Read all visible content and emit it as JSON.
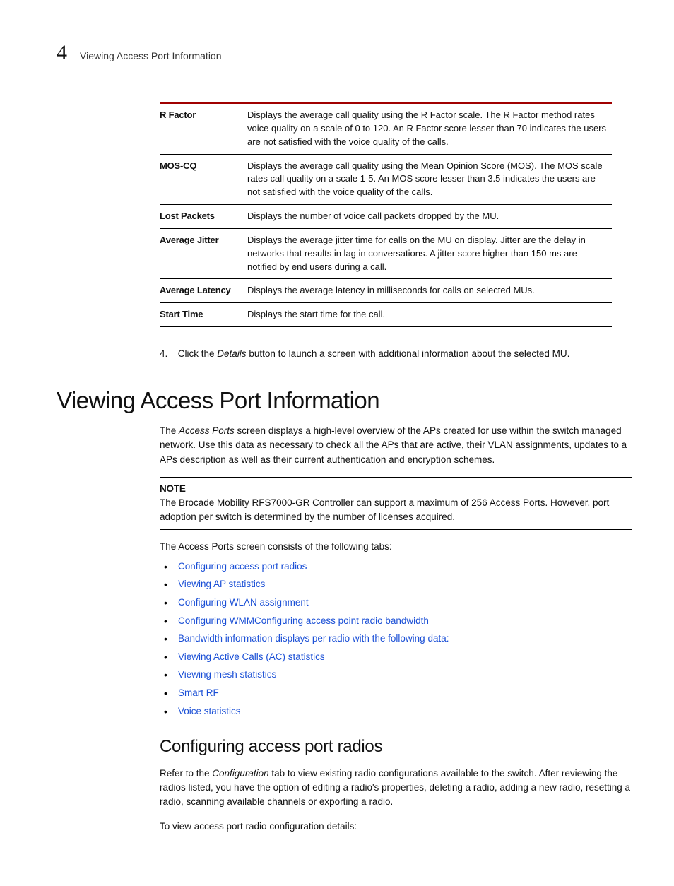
{
  "header": {
    "chapter_number": "4",
    "chapter_title": "Viewing Access Port Information"
  },
  "table": {
    "rows": [
      {
        "term": "R Factor",
        "desc": "Displays the average call quality using the R Factor scale. The R Factor method rates voice quality on a scale of 0 to 120. An R Factor score lesser than 70 indicates the users are not satisfied with the voice quality of the calls."
      },
      {
        "term": "MOS-CQ",
        "desc": "Displays the average call quality using the Mean Opinion Score (MOS). The MOS scale rates call quality on a scale 1-5. An MOS score lesser than 3.5 indicates the users are not satisfied with the voice quality of the calls."
      },
      {
        "term": "Lost Packets",
        "desc": "Displays the number of voice call packets dropped by the MU."
      },
      {
        "term": "Average Jitter",
        "desc": "Displays the average jitter time for calls on the MU on display. Jitter are the delay in networks that results in lag in conversations. A jitter score higher than 150 ms are notified by end users during a call."
      },
      {
        "term": "Average Latency",
        "desc": "Displays the average latency in milliseconds for calls on selected MUs."
      },
      {
        "term": "Start Time",
        "desc": "Displays the start time for the call."
      }
    ]
  },
  "step": {
    "number": "4.",
    "pre": "Click the ",
    "em": "Details",
    "post": " button to launch a screen with additional information about the selected MU."
  },
  "section": {
    "title": "Viewing Access Port Information",
    "intro_pre": "The ",
    "intro_em": "Access Ports",
    "intro_post": " screen displays a high-level overview of the APs created for use within the switch managed network. Use this data as necessary to check all the APs that are active, their VLAN assignments, updates to a APs description as well as their current authentication and encryption schemes."
  },
  "note": {
    "heading": "NOTE",
    "body": "The Brocade Mobility RFS7000-GR Controller can support a maximum of 256 Access Ports. However, port adoption per switch is determined by the number of licenses acquired."
  },
  "tabs_lead": "The Access Ports screen consists of the following tabs:",
  "tabs": [
    "Configuring access port radios",
    "Viewing AP statistics",
    "Configuring WLAN assignment",
    "Configuring WMMConfiguring access point radio bandwidth",
    "Bandwidth information displays per radio with the following data:",
    "Viewing Active Calls (AC) statistics",
    "Viewing mesh statistics",
    "Smart RF",
    "Voice statistics"
  ],
  "subsection": {
    "title": "Configuring access port radios",
    "para1_pre": "Refer to the ",
    "para1_em": "Configuration",
    "para1_post": " tab to view existing radio configurations available to the switch. After reviewing the radios listed, you have the option of editing a radio's properties, deleting a radio, adding a new radio, resetting a radio, scanning available channels or exporting a radio.",
    "para2": "To view access port radio configuration details:"
  }
}
